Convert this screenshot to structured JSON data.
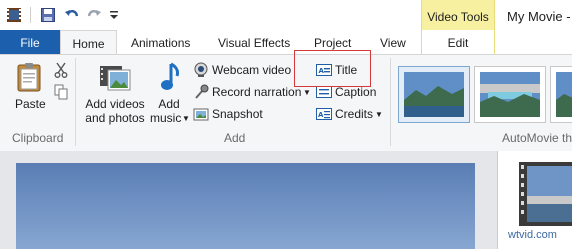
{
  "title_bar": {
    "window_title": "My Movie -",
    "contextual_group": "Video Tools"
  },
  "tabs": [
    {
      "label": "File"
    },
    {
      "label": "Home"
    },
    {
      "label": "Animations"
    },
    {
      "label": "Visual Effects"
    },
    {
      "label": "Project"
    },
    {
      "label": "View"
    },
    {
      "label": "Edit"
    }
  ],
  "ribbon": {
    "clipboard": {
      "paste": "Paste",
      "group_label": "Clipboard"
    },
    "add": {
      "add_videos_line1": "Add videos",
      "add_videos_line2": "and photos",
      "add_music_line1": "Add",
      "add_music_line2": "music",
      "webcam_video": "Webcam video",
      "record_narration": "Record narration",
      "snapshot": "Snapshot",
      "title": "Title",
      "caption": "Caption",
      "credits": "Credits",
      "group_label": "Add"
    },
    "automovie": {
      "group_label": "AutoMovie th"
    }
  },
  "watermark": "wtvid.com",
  "colors": {
    "file_tab": "#1b5fad",
    "contextual_tab": "#f6f0a0",
    "highlight_box": "#d33a3a",
    "ribbon_bg": "#f5f6f7"
  }
}
